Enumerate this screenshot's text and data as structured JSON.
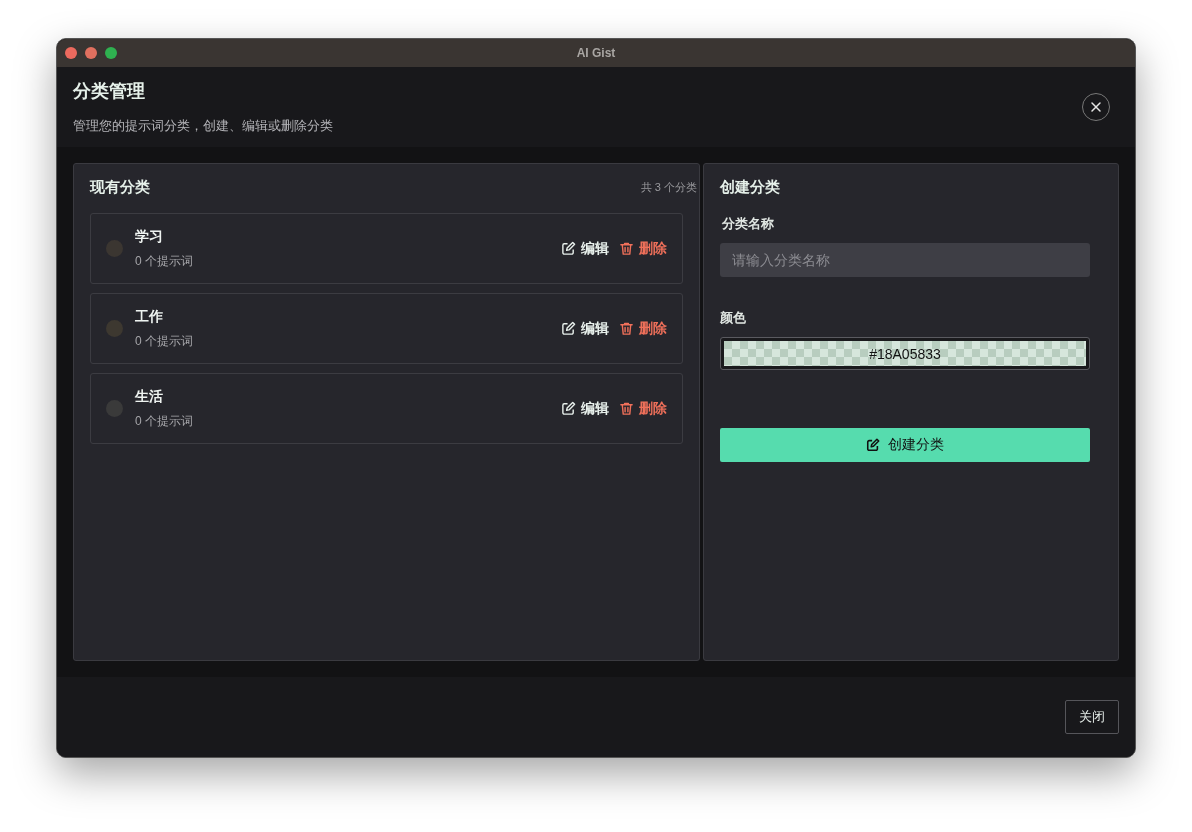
{
  "window": {
    "title": "AI Gist"
  },
  "dialog": {
    "title": "分类管理",
    "subtitle": "管理您的提示词分类，创建、编辑或删除分类",
    "close_label": "关闭"
  },
  "existing": {
    "title": "现有分类",
    "count": "共 3 个分类",
    "categories": [
      {
        "name": "学习",
        "prompts": "0 个提示词",
        "color": "#3b3631",
        "edit": "编辑",
        "delete": "删除"
      },
      {
        "name": "工作",
        "prompts": "0 个提示词",
        "color": "#3d3830",
        "edit": "编辑",
        "delete": "删除"
      },
      {
        "name": "生活",
        "prompts": "0 个提示词",
        "color": "#3a3a3a",
        "edit": "编辑",
        "delete": "删除"
      }
    ]
  },
  "create": {
    "title": "创建分类",
    "name_label": "分类名称",
    "name_placeholder": "请输入分类名称",
    "color_label": "颜色",
    "color_value": "#18A05833",
    "button": "创建分类"
  }
}
